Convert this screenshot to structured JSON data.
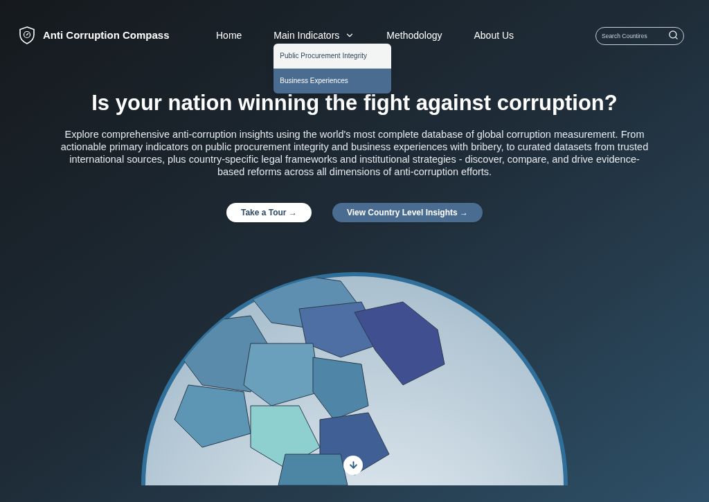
{
  "brand": {
    "name": "Anti Corruption Compass"
  },
  "nav": [
    {
      "label": "Home",
      "kind": "link"
    },
    {
      "label": "Main Indicators",
      "kind": "dropdown",
      "expanded": true,
      "items": [
        {
          "label": "Public Procurement Integrity",
          "selected": false
        },
        {
          "label": "Business Experiences",
          "selected": true
        }
      ]
    },
    {
      "label": "Methodology",
      "kind": "link"
    },
    {
      "label": "About Us",
      "kind": "link"
    }
  ],
  "search": {
    "placeholder": "Search Countires"
  },
  "hero": {
    "title": "Is your nation winning the fight against corruption?",
    "text": "Explore comprehensive anti-corruption insights using the world's most complete database of global corruption measurement. From actionable primary indicators on public procurement integrity and business experiences with bribery, to curated datasets from trusted international sources, plus country-specific legal frameworks and institutional strategies - discover, compare, and drive evidence-based reforms across all dimensions of anti-corruption efforts.",
    "buttons": [
      {
        "label": "Take a Tour →",
        "kind": "primary"
      },
      {
        "label": "View Country Level Insights →",
        "kind": "secondary"
      }
    ]
  }
}
